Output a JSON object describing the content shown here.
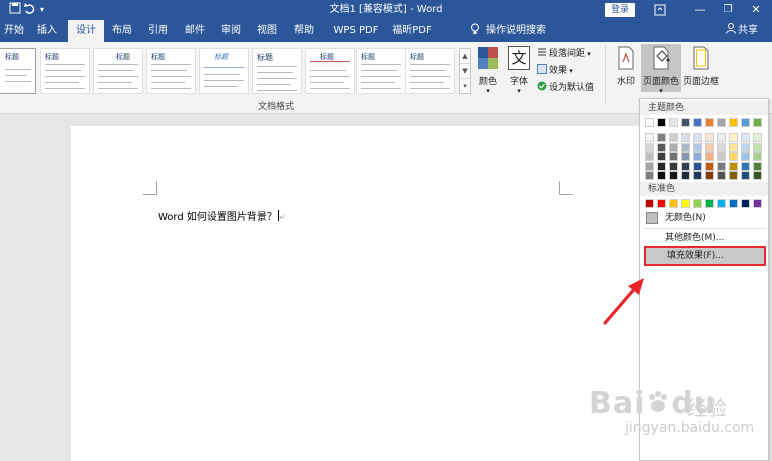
{
  "titlebar": {
    "title": "文档1 [兼容模式] - Word",
    "login": "登录",
    "save_icon": "save-icon",
    "undo_icon": "undo-icon",
    "redo_icon": "redo-icon",
    "customize_icon": "dropdown-icon",
    "restore_icon": "ribbon-display-icon",
    "minimize": "—",
    "maximize": "❐",
    "close": "✕"
  },
  "tabs": [
    {
      "label": "开始"
    },
    {
      "label": "插入"
    },
    {
      "label": "设计"
    },
    {
      "label": "布局"
    },
    {
      "label": "引用"
    },
    {
      "label": "邮件"
    },
    {
      "label": "审阅"
    },
    {
      "label": "视图"
    },
    {
      "label": "帮助"
    },
    {
      "label": "WPS PDF"
    },
    {
      "label": "福昕PDF"
    }
  ],
  "tell_me": "操作说明搜索",
  "share": "共享",
  "ribbon": {
    "style_title": "标题",
    "style_heading1": "标题 1",
    "group_label": "文档格式",
    "colors_label": "颜色",
    "fonts_label": "字体",
    "fonts_glyph": "文",
    "paragraph_spacing": "段落间距",
    "effects": "效果",
    "set_default": "设为默认值",
    "watermark": "水印",
    "page_color": "页面颜色",
    "page_borders": "页面边框"
  },
  "document": {
    "text": "Word 如何设置图片背景？"
  },
  "dropdown": {
    "theme_colors_header": "主题颜色",
    "standard_colors_header": "标准色",
    "no_color": "无颜色(N)",
    "more_colors": "其他颜色(M)...",
    "fill_effects": "填充效果(F)...",
    "theme_top_row": [
      "#ffffff",
      "#000000",
      "#e7e6e6",
      "#44546a",
      "#4472c4",
      "#ed7d31",
      "#a5a5a5",
      "#ffc000",
      "#5b9bd5",
      "#70ad47"
    ],
    "theme_tints": [
      [
        "#f2f2f2",
        "#7f7f7f",
        "#d0cece",
        "#d6dce4",
        "#d9e2f3",
        "#fbe5d5",
        "#ededed",
        "#fff2cc",
        "#deebf6",
        "#e2efd9"
      ],
      [
        "#d8d8d8",
        "#595959",
        "#aeabab",
        "#adb9ca",
        "#b4c6e7",
        "#f7cbac",
        "#dbdbdb",
        "#fee599",
        "#bdd7ee",
        "#c5e0b3"
      ],
      [
        "#bfbfbf",
        "#3f3f3f",
        "#757070",
        "#8496b0",
        "#8eaadb",
        "#f4b183",
        "#c9c9c9",
        "#ffd966",
        "#9cc3e5",
        "#a8d08d"
      ],
      [
        "#a5a5a5",
        "#262626",
        "#3a3838",
        "#323f4f",
        "#2f5496",
        "#c45911",
        "#7b7b7b",
        "#bf8f00",
        "#2e75b5",
        "#538135"
      ],
      [
        "#7f7f7f",
        "#0c0c0c",
        "#171616",
        "#222a35",
        "#1f3864",
        "#833c0b",
        "#525252",
        "#7f6000",
        "#1e4e79",
        "#375623"
      ]
    ],
    "standard_colors": [
      "#c00000",
      "#ff0000",
      "#ffc000",
      "#ffff00",
      "#92d050",
      "#00b050",
      "#00b0f0",
      "#0070c0",
      "#002060",
      "#7030a0"
    ],
    "no_color_swatch": "#c0c0c0"
  },
  "colors": {
    "accent": "#2b579a",
    "highlight_border": "#e8262b",
    "arrow": "#e8262b"
  },
  "watermark": {
    "brand": "Bai",
    "brand2": "du",
    "jingyan": "经验",
    "sub": "jingyan.baidu.com"
  }
}
